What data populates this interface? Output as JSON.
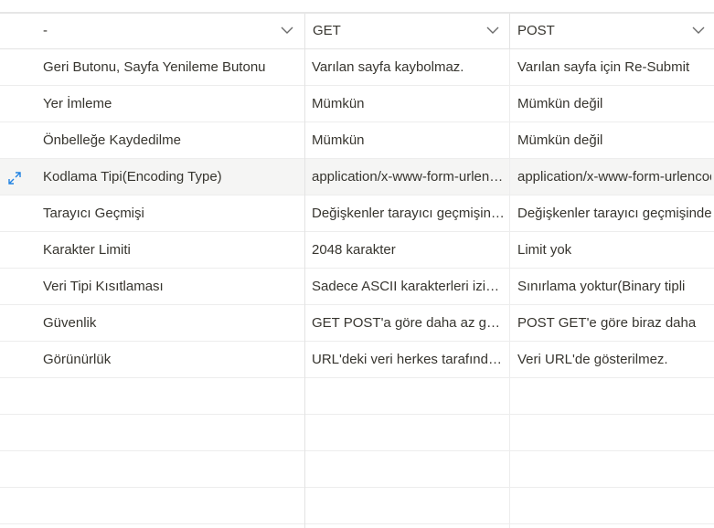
{
  "columns": [
    {
      "label": "-",
      "icon": "chevron-down-icon"
    },
    {
      "label": "GET",
      "icon": "chevron-down-icon"
    },
    {
      "label": "POST",
      "icon": "chevron-down-icon"
    }
  ],
  "rows": [
    {
      "name": "Geri Butonu, Sayfa Yenileme Butonu",
      "get": "Varılan sayfa kaybolmaz.",
      "post": "Varılan sayfa için Re-Submit"
    },
    {
      "name": "Yer İmleme",
      "get": "Mümkün",
      "post": "Mümkün değil"
    },
    {
      "name": "Önbelleğe Kaydedilme",
      "get": "Mümkün",
      "post": "Mümkün değil"
    },
    {
      "name": "Kodlama Tipi(Encoding Type)",
      "get": "application/x-www-form-urlencoded",
      "post": "application/x-www-form-urlencoded",
      "highlighted": true,
      "icon": "expand-icon"
    },
    {
      "name": "Tarayıcı Geçmişi",
      "get": "Değişkenler tarayıcı geçmişinde kalır",
      "post": "Değişkenler tarayıcı geçmişinde kalmaz"
    },
    {
      "name": "Karakter Limiti",
      "get": "2048 karakter",
      "post": "Limit yok"
    },
    {
      "name": "Veri Tipi Kısıtlaması",
      "get": "Sadece ASCII karakterleri izin verilir",
      "post": "Sınırlama yoktur(Binary tipli"
    },
    {
      "name": "Güvenlik",
      "get": "GET POST'a göre daha az güvenlidir",
      "post": "POST GET'e göre biraz daha"
    },
    {
      "name": "Görünürlük",
      "get": "URL'deki veri herkes tarafından görülebilir",
      "post": "Veri URL'de gösterilmez."
    },
    {
      "name": "",
      "get": "",
      "post": ""
    },
    {
      "name": "",
      "get": "",
      "post": ""
    },
    {
      "name": "",
      "get": "",
      "post": ""
    },
    {
      "name": "",
      "get": "",
      "post": ""
    }
  ],
  "colors": {
    "border": "#e3e3e3",
    "highlight": "#f5f5f4",
    "text": "#37352f",
    "accent": "#2383e2"
  }
}
